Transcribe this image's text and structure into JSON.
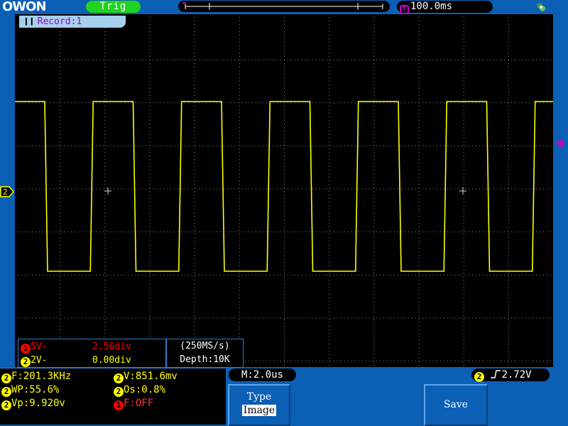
{
  "topbar": {
    "logo": "OWON",
    "trigger_status": "Trig",
    "timebase": "100.0ms",
    "timebase_icon": "time-icon",
    "usb_icon": "usb-icon"
  },
  "record_label": "Record:1",
  "channel_marker": "2",
  "channel_info": {
    "ch1": {
      "badge": "1",
      "volts": "5V-",
      "offset": "2.56div"
    },
    "ch2": {
      "badge": "2",
      "volts": "2V-",
      "offset": "0.00div"
    }
  },
  "sampling": {
    "rate": "(250MS/s)",
    "depth": "Depth:10K"
  },
  "measurements": [
    {
      "badge": "2",
      "text": "F:201.3KHz"
    },
    {
      "badge": "2",
      "text": "V:851.6mv"
    },
    {
      "badge": "2",
      "text": "WP:55.6%"
    },
    {
      "badge": "2",
      "text": "Os:0.8%"
    },
    {
      "badge": "2",
      "text": "Vp:9.920v"
    },
    {
      "badge": "1",
      "text": "F:OFF"
    }
  ],
  "horizontal_time": "M:2.0us",
  "trigger": {
    "badge": "2",
    "level": "2.72V"
  },
  "softkeys": {
    "type_label": "Type",
    "type_value": "Image",
    "save_label": "Save"
  },
  "colors": {
    "trace": "#ffff00",
    "ch1": "#ff0000",
    "background": "#0b5fb4",
    "screen": "#000000",
    "trigger_marker": "#cc00cc"
  }
}
